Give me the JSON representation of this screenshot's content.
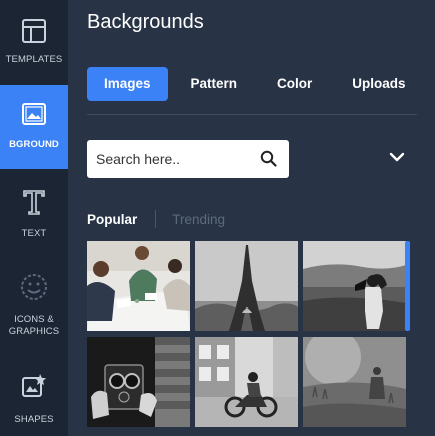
{
  "sidebar": {
    "items": [
      {
        "label": "TEMPLATES",
        "icon": "templates-icon"
      },
      {
        "label": "BGROUND",
        "icon": "background-icon",
        "active": true
      },
      {
        "label": "TEXT",
        "icon": "text-icon"
      },
      {
        "label": "ICONS &\nGRAPHICS",
        "icon": "smiley-icon"
      },
      {
        "label": "SHAPES",
        "icon": "shapes-icon"
      }
    ]
  },
  "panel": {
    "title": "Backgrounds",
    "tabs": [
      {
        "label": "Images",
        "active": true
      },
      {
        "label": "Pattern"
      },
      {
        "label": "Color"
      },
      {
        "label": "Uploads"
      }
    ],
    "search": {
      "placeholder": "Search here.."
    },
    "subtabs": {
      "popular": "Popular",
      "trending": "Trending"
    },
    "images": [
      {
        "desc": "people meeting at table"
      },
      {
        "desc": "eiffel tower"
      },
      {
        "desc": "woman with camera on beach"
      },
      {
        "desc": "vintage camera hands"
      },
      {
        "desc": "motorcycle street"
      },
      {
        "desc": "person in foggy field"
      }
    ]
  },
  "colors": {
    "accent": "#3b82f6",
    "rail": "#1c2533",
    "panel": "#283446"
  }
}
